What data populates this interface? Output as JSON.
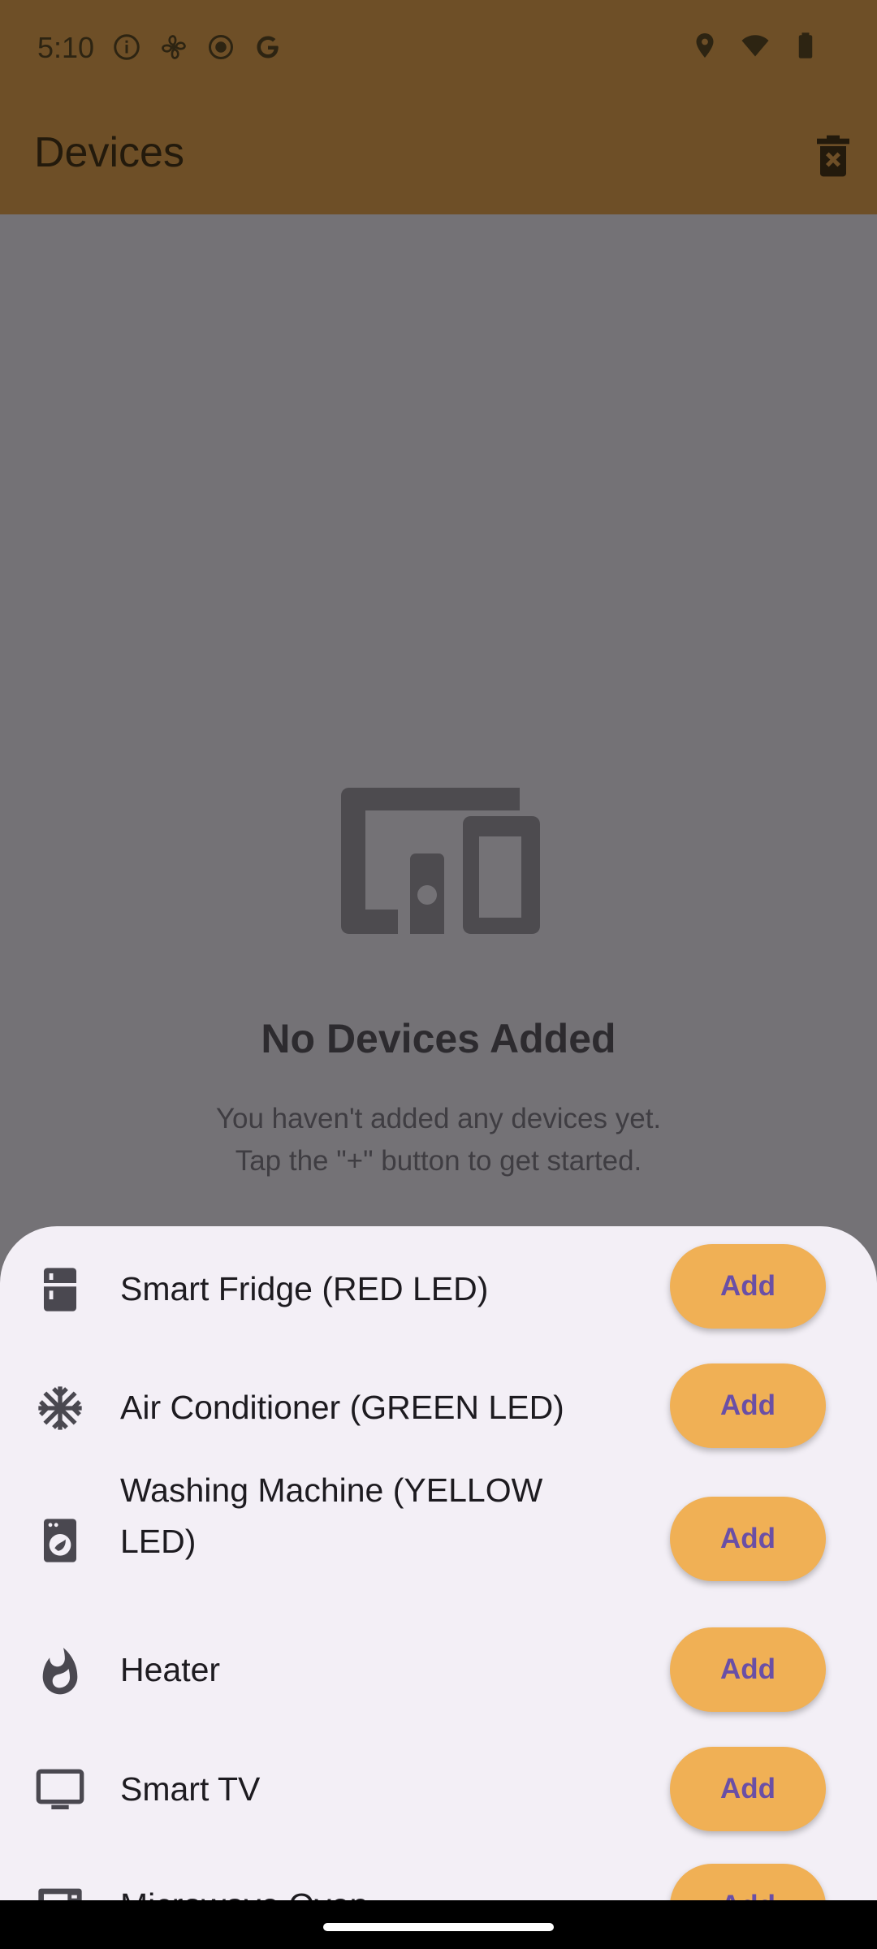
{
  "status": {
    "time": "5:10",
    "left_icons": [
      "info-icon",
      "fan-icon",
      "radio-button-icon",
      "google-g-icon"
    ],
    "right_icons": [
      "location-icon",
      "wifi-icon",
      "battery-icon"
    ]
  },
  "app_bar": {
    "title": "Devices",
    "action_icon": "delete-sweep-icon"
  },
  "empty_state": {
    "icon": "devices-icon",
    "title": "No Devices Added",
    "line1": "You haven't added any devices yet.",
    "line2": "Tap the \"+\" button to get started."
  },
  "sheet": {
    "items": [
      {
        "label": "Smart Fridge (RED LED)",
        "icon": "fridge-icon",
        "button": "Add"
      },
      {
        "label": "Air Conditioner (GREEN LED)",
        "icon": "snowflake-icon",
        "button": "Add"
      },
      {
        "label": "Washing Machine (YELLOW LED)",
        "icon": "washing-machine-icon",
        "button": "Add"
      },
      {
        "label": "Heater",
        "icon": "flame-icon",
        "button": "Add"
      },
      {
        "label": "Smart TV",
        "icon": "tv-icon",
        "button": "Add"
      },
      {
        "label": "Microwave Oven",
        "icon": "microwave-icon",
        "button": "Add"
      }
    ]
  },
  "colors": {
    "scrim": "#747276",
    "app_bar": "#6e4f27",
    "sheet": "#f3eff6",
    "add_button": "#f0b055",
    "add_text": "#6a4fa6"
  }
}
